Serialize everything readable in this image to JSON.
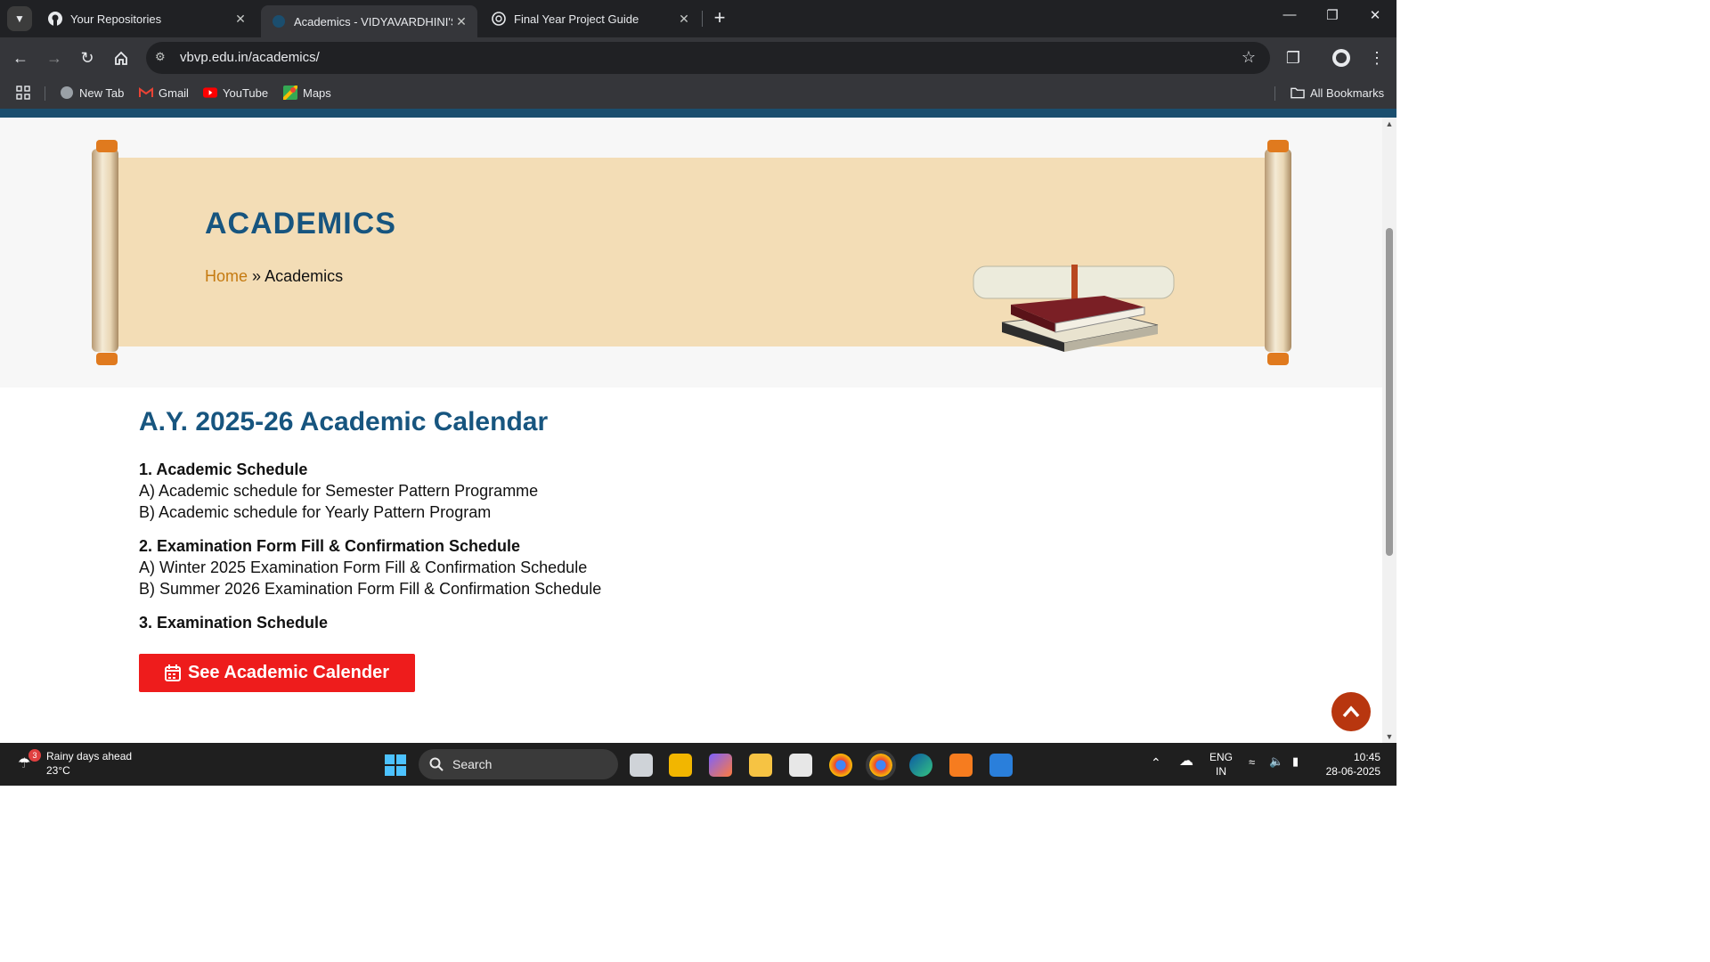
{
  "browser": {
    "tabs": [
      {
        "title": "Your Repositories",
        "icon": "github-icon",
        "active": false
      },
      {
        "title": "Academics - VIDYAVARDHINI'S",
        "icon": "site-icon",
        "active": true
      },
      {
        "title": "Final Year Project Guide",
        "icon": "chatgpt-icon",
        "active": false
      }
    ],
    "url": "vbvp.edu.in/academics/",
    "bookmarks": [
      "New Tab",
      "Gmail",
      "YouTube",
      "Maps"
    ],
    "all_bookmarks_label": "All Bookmarks"
  },
  "page": {
    "hero_title": "ACADEMICS",
    "breadcrumb": {
      "home": "Home",
      "separator": "»",
      "current": "Academics"
    },
    "calendar_title": "A.Y. 2025-26 Academic Calendar",
    "sections": [
      {
        "heading": "1. Academic Schedule",
        "items": [
          "A) Academic schedule for Semester Pattern Programme",
          "B) Academic schedule for Yearly Pattern Program"
        ]
      },
      {
        "heading": "2. Examination Form Fill & Confirmation Schedule",
        "items": [
          "A) Winter 2025 Examination Form Fill & Confirmation Schedule",
          "B) Summer 2026 Examination Form Fill & Confirmation Schedule"
        ]
      },
      {
        "heading": "3. Examination Schedule",
        "items": []
      }
    ],
    "cta_button": "See Academic Calender",
    "colors": {
      "title_blue": "#17557f",
      "cta_red": "#ee1c1c",
      "to_top": "#b8360f",
      "scroll_parchment": "#f3ddb6"
    }
  },
  "taskbar": {
    "weather_badge": "3",
    "weather_line1": "Rainy days ahead",
    "weather_line2": "23°C",
    "search_label": "Search",
    "lang_line1": "ENG",
    "lang_line2": "IN",
    "time": "10:45",
    "date": "28-06-2025"
  }
}
